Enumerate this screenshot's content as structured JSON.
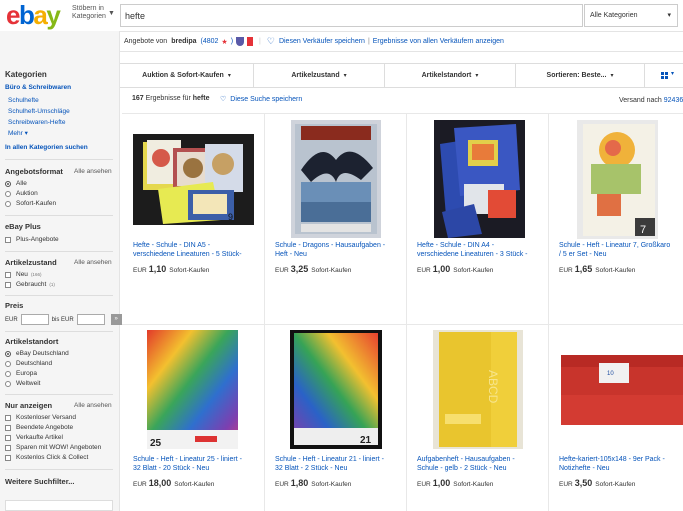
{
  "header": {
    "logo": [
      "e",
      "b",
      "a",
      "y"
    ],
    "browse_line1": "Stöbern in",
    "browse_line2": "Kategorien",
    "search_value": "hefte",
    "category_select": "Alle Kategorien"
  },
  "seller": {
    "prefix": "Angebote von",
    "name": "bredipa",
    "feedback_open": "(4802",
    "feedback_close": ")",
    "save_seller": "Diesen Verkäufer speichern",
    "separator": "|",
    "all_sellers": "Ergebnisse von allen Verkäufern anzeigen"
  },
  "sidebar": {
    "categories_title": "Kategorien",
    "category_main": "Büro & Schreibwaren",
    "sub_items": [
      "Schulhefte",
      "Schulheft-Umschläge",
      "Schreibwaren-Hefte",
      "Mehr"
    ],
    "all_categories": "In allen Kategorien suchen",
    "format_title": "Angebotsformat",
    "format_all_link": "Alle ansehen",
    "format_options": [
      "Alle",
      "Auktion",
      "Sofort-Kaufen"
    ],
    "ebayplus_title": "eBay Plus",
    "ebayplus_option": "Plus-Angebote",
    "condition_title": "Artikelzustand",
    "condition_all_link": "Alle ansehen",
    "condition_options": [
      {
        "label": "Neu",
        "count": "(166)"
      },
      {
        "label": "Gebraucht",
        "count": "(1)"
      }
    ],
    "price_title": "Preis",
    "price_from_label": "EUR",
    "price_to_label": "bis EUR",
    "price_go": "»",
    "location_title": "Artikelstandort",
    "location_options": [
      "eBay Deutschland",
      "Deutschland",
      "Europa",
      "Weltweit"
    ],
    "only_title": "Nur anzeigen",
    "only_all_link": "Alle ansehen",
    "only_options": [
      "Kostenloser Versand",
      "Beendete Angebote",
      "Verkaufte Artikel",
      "Sparen mit WOW! Angeboten",
      "Kostenlos Click & Collect"
    ],
    "more_filters": "Weitere Suchfilter..."
  },
  "filters": {
    "items": [
      "Auktion & Sofort-Kaufen",
      "Artikelzustand",
      "Artikelstandort",
      "Sortieren: Beste..."
    ],
    "caret": "▾"
  },
  "results": {
    "count": "167",
    "count_text": "Ergebnisse für",
    "query": "hefte",
    "save_search": "Diese Suche speichern",
    "ship_to": "Versand nach",
    "ship_zip": "92436"
  },
  "products": [
    {
      "title": "Hefte - Schule - DIN A5 -\nverschiedene Lineaturen - 5 Stück-",
      "currency": "EUR",
      "price": "1,10",
      "mode": "Sofort-Kaufen"
    },
    {
      "title": "Schule - Dragons - Hausaufgaben -\nHeft - Neu",
      "currency": "EUR",
      "price": "3,25",
      "mode": "Sofort-Kaufen"
    },
    {
      "title": "Hefte - Schule - DIN A4 -\nverschiedene Lineaturen - 3 Stück -",
      "currency": "EUR",
      "price": "1,00",
      "mode": "Sofort-Kaufen"
    },
    {
      "title": "Schule - Heft - Lineatur 7, Großkaro\n/ 5 er Set - Neu",
      "currency": "EUR",
      "price": "1,65",
      "mode": "Sofort-Kaufen"
    },
    {
      "title": "Schule - Heft - Lineatur 25 - liniert -\n32 Blatt - 20 Stück - Neu",
      "currency": "EUR",
      "price": "18,00",
      "mode": "Sofort-Kaufen"
    },
    {
      "title": "Schule - Heft - Lineatur 21 - liniert -\n32 Blatt - 2 Stück - Neu",
      "currency": "EUR",
      "price": "1,80",
      "mode": "Sofort-Kaufen"
    },
    {
      "title": "Aufgabenheft - Hausaufgaben -\nSchule - gelb - 2 Stück - Neu",
      "currency": "EUR",
      "price": "1,00",
      "mode": "Sofort-Kaufen"
    },
    {
      "title": "Hefte-kariert-105x148 - 9er Pack -\nNotizhefte - Neu",
      "currency": "EUR",
      "price": "3,50",
      "mode": "Sofort-Kaufen"
    }
  ],
  "product_image_text": {
    "p4_badge": "7",
    "p5_number": "25",
    "p6_number": "21",
    "p7_letters": "ABCD",
    "p8_label": "10"
  },
  "colors": {
    "link": "#0654ba",
    "logo_red": "#e53238",
    "logo_blue": "#0064d2",
    "logo_yellow": "#f5af02",
    "logo_green": "#86b817"
  }
}
